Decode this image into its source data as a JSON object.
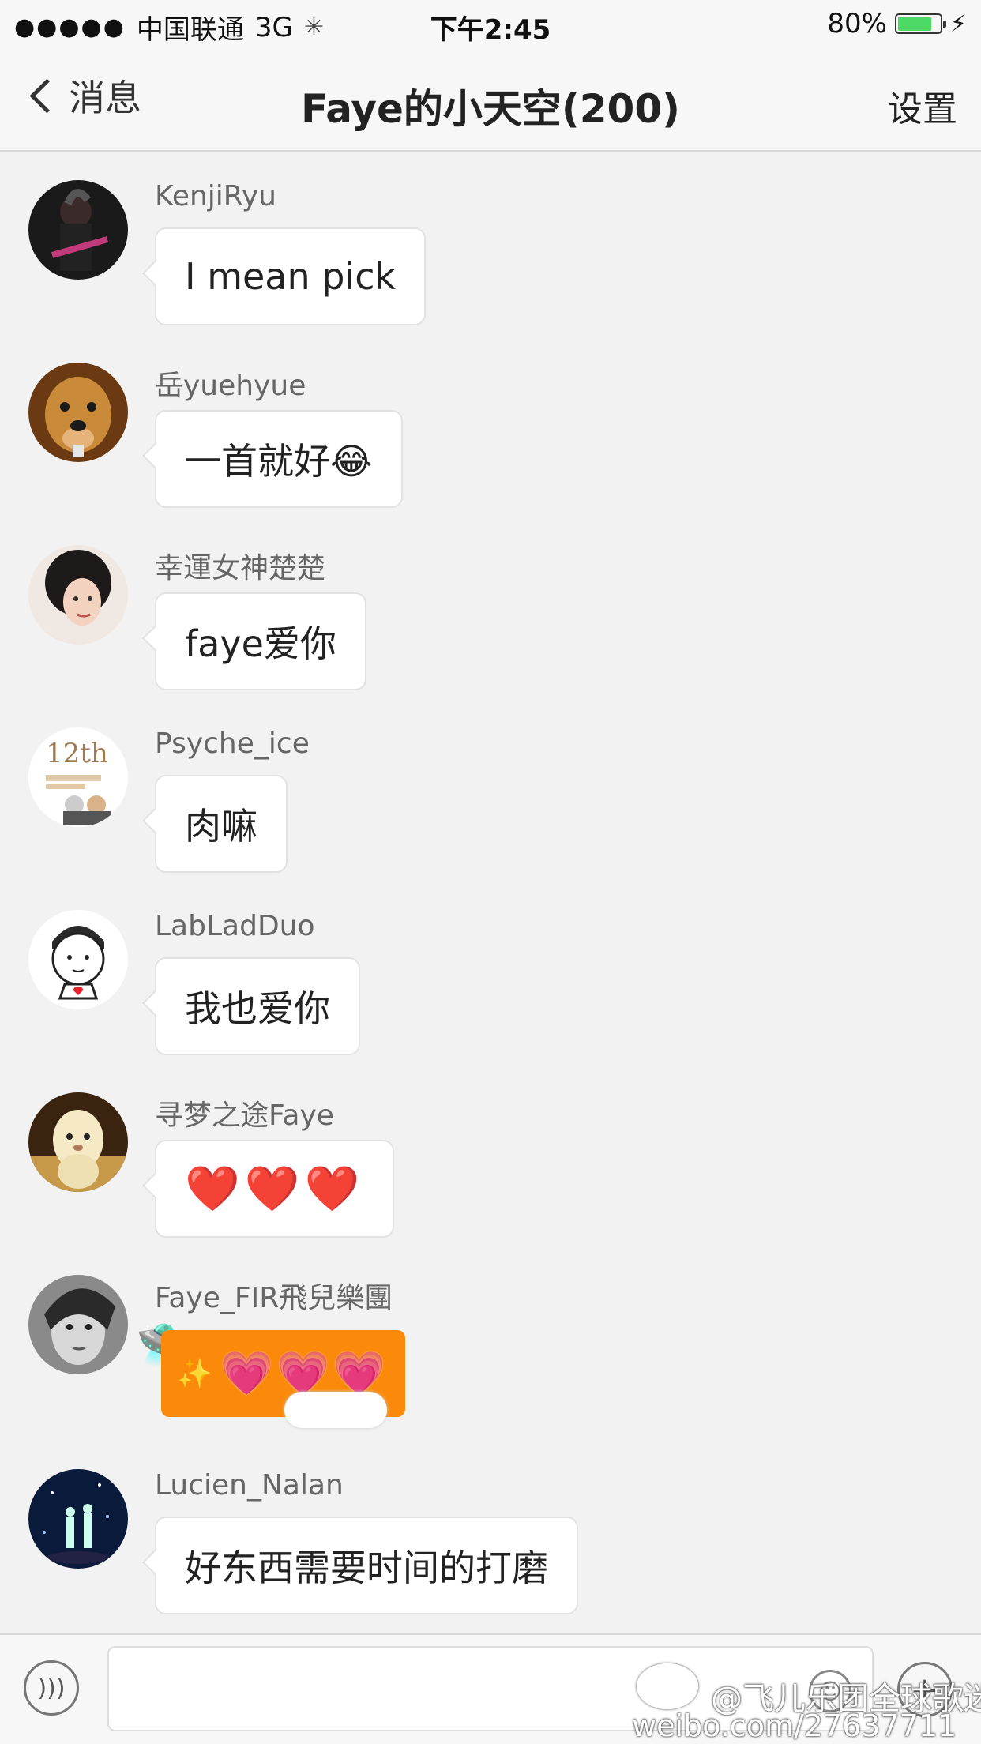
{
  "status_bar": {
    "signal_dots": "●●●●●",
    "carrier": "中国联通",
    "network": "3G",
    "time": "下午2:45",
    "battery_percent": "80%",
    "battery_level": 0.8
  },
  "navbar": {
    "back_label": "消息",
    "title": "Faye的小天空(200)",
    "settings_label": "设置"
  },
  "messages": [
    {
      "username": "KenjiRyu",
      "text": "I mean pick"
    },
    {
      "username": "岳yuehyue",
      "text": "一首就好😂"
    },
    {
      "username": "幸運女神楚楚",
      "text": "faye爱你"
    },
    {
      "username": "Psyche_ice",
      "text": "肉嘛",
      "avatar_text": "12th"
    },
    {
      "username": "LabLadDuo",
      "text": "我也爱你"
    },
    {
      "username": "寻梦之途Faye",
      "text": "❤️❤️❤️"
    },
    {
      "username": "Faye_FIR飛兒樂團",
      "text": "💗💗💗"
    },
    {
      "username": "Lucien_Nalan",
      "text": "好东西需要时间的打磨"
    }
  ],
  "input_bar": {
    "voice_icon": "voice-icon",
    "emoji_icon": "emoji-icon",
    "plus_icon": "plus-icon"
  },
  "watermark": {
    "line1": "@飞儿乐团全球歌迷网",
    "line2": "weibo.com/27637711"
  },
  "colors": {
    "background": "#f2f2f2",
    "bubble": "#ffffff",
    "orange_bubble": "#fb8a0b",
    "battery_fill": "#4cd964"
  }
}
